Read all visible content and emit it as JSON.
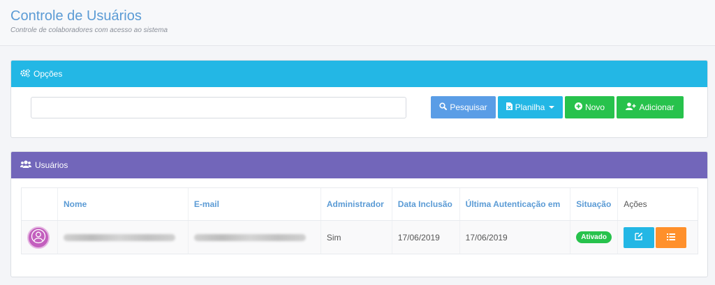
{
  "header": {
    "title": "Controle de Usuários",
    "subtitle": "Controle de colaboradores com acesso ao sistema"
  },
  "options_panel": {
    "title": "Opções",
    "search": {
      "value": "",
      "placeholder": ""
    },
    "buttons": {
      "search": "Pesquisar",
      "sheet": "Planilha",
      "new": "Novo",
      "add": "Adicionar"
    }
  },
  "users_panel": {
    "title": "Usuários",
    "columns": [
      "",
      "Nome",
      "E-mail",
      "Administrador",
      "Data Inclusão",
      "Última Autenticação em",
      "Situação",
      "Ações"
    ],
    "rows": [
      {
        "name": "",
        "email": "",
        "admin": "Sim",
        "created": "17/06/2019",
        "last_auth": "17/06/2019",
        "status": "Ativado"
      }
    ]
  },
  "colors": {
    "options_heading": "#23b7e5",
    "users_heading": "#7266ba",
    "primary": "#5a9de6",
    "info": "#23b7e5",
    "success": "#27c24c",
    "warning": "#ff902b",
    "title": "#5b9bd5"
  },
  "icons": {
    "options": "cogs-icon",
    "search": "search-icon",
    "sheet": "file-excel-icon",
    "new": "plus-circle-icon",
    "add": "user-plus-icon",
    "users": "users-icon",
    "avatar": "user-circle-icon",
    "edit": "edit-icon",
    "list": "list-icon"
  }
}
